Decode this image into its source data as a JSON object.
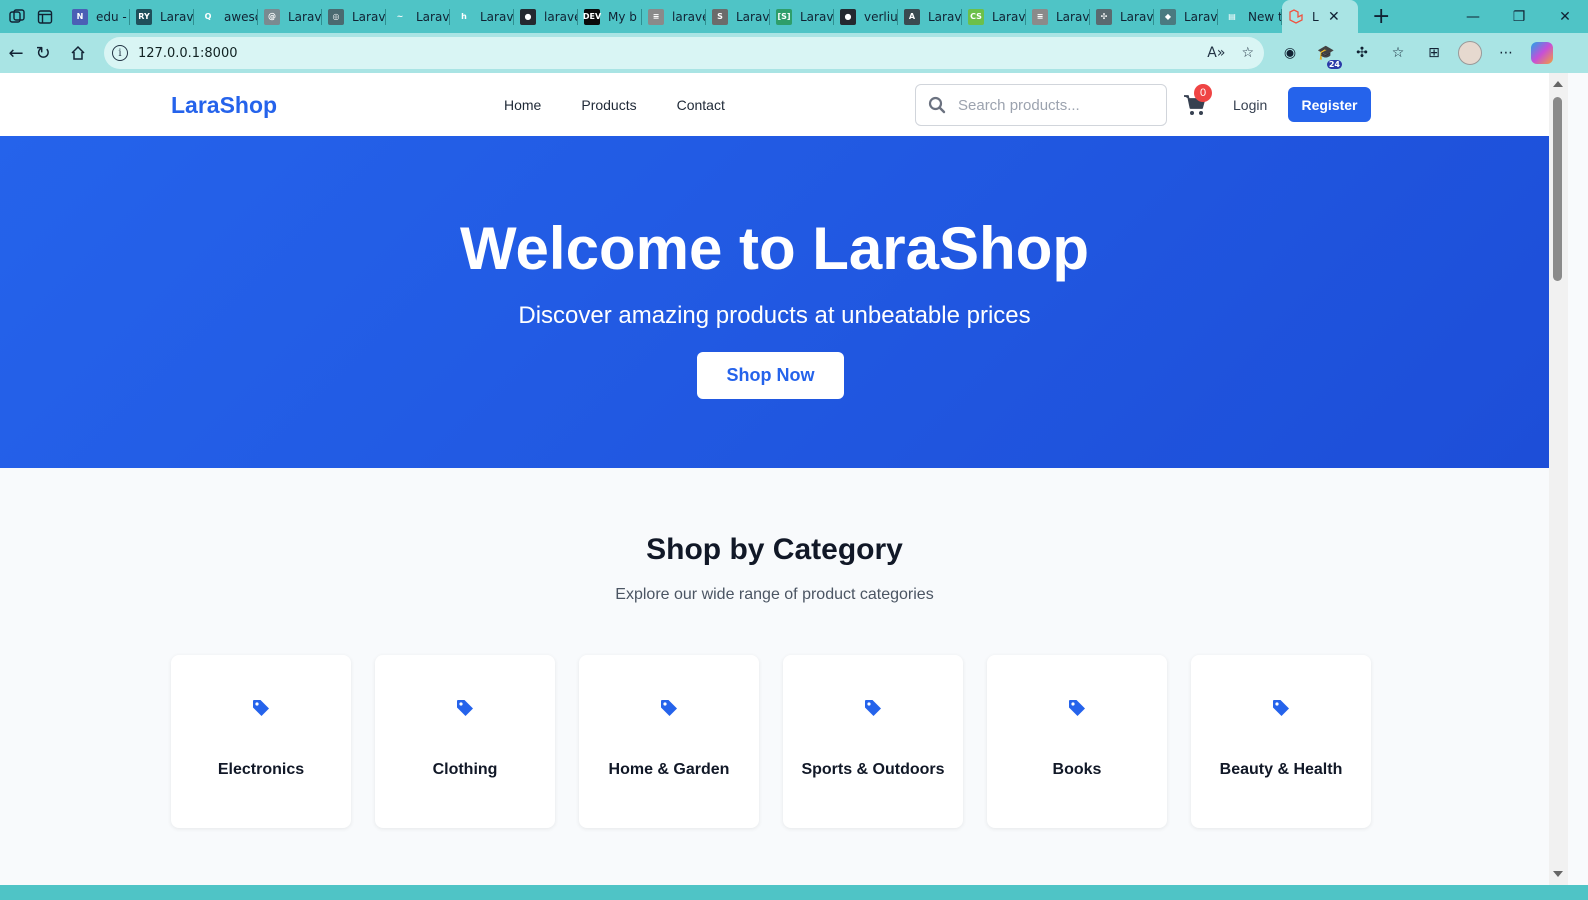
{
  "browser": {
    "tabs": [
      {
        "title": "edu -",
        "favicon_color": "#4b5fb5",
        "favicon_text": "N"
      },
      {
        "title": "Larav",
        "favicon_color": "#1f4f5a",
        "favicon_text": "RY"
      },
      {
        "title": "awesc",
        "favicon_color": "#4fc4c6",
        "favicon_text": "Q"
      },
      {
        "title": "Larav",
        "favicon_color": "#7a8a90",
        "favicon_text": "@"
      },
      {
        "title": "Larav",
        "favicon_color": "#4a6a70",
        "favicon_text": "◎"
      },
      {
        "title": "Larav",
        "favicon_color": "#4fc4c6",
        "favicon_text": "~"
      },
      {
        "title": "Larav",
        "favicon_color": "#4fc4c6",
        "favicon_text": "h"
      },
      {
        "title": "larave",
        "favicon_color": "#24292f",
        "favicon_text": "●"
      },
      {
        "title": "My b",
        "favicon_color": "#0a0a0a",
        "favicon_text": "DEV"
      },
      {
        "title": "larave",
        "favicon_color": "#8a8a8a",
        "favicon_text": "≡"
      },
      {
        "title": "Larav",
        "favicon_color": "#6b6b6b",
        "favicon_text": "S"
      },
      {
        "title": "Larav",
        "favicon_color": "#2e9e6a",
        "favicon_text": "[S]"
      },
      {
        "title": "verliu",
        "favicon_color": "#24292f",
        "favicon_text": "●"
      },
      {
        "title": "Larav",
        "favicon_color": "#3a4a50",
        "favicon_text": "A"
      },
      {
        "title": "Larav",
        "favicon_color": "#6cc04a",
        "favicon_text": "CS"
      },
      {
        "title": "Larav",
        "favicon_color": "#8a8a8a",
        "favicon_text": "≡"
      },
      {
        "title": "Larav",
        "favicon_color": "#5a6a70",
        "favicon_text": "✣"
      },
      {
        "title": "Larav",
        "favicon_color": "#4a7a80",
        "favicon_text": "◆"
      },
      {
        "title": "New t",
        "favicon_color": "#4fc4c6",
        "favicon_text": "▤"
      }
    ],
    "active_tab": {
      "title": "L",
      "favicon_color": "#f05340"
    },
    "url": "127.0.0.1:8000",
    "extension_badge": "24"
  },
  "site": {
    "logo": "LaraShop",
    "nav": {
      "home": "Home",
      "products": "Products",
      "contact": "Contact"
    },
    "search": {
      "placeholder": "Search products..."
    },
    "cart_count": "0",
    "login": "Login",
    "register": "Register",
    "accent_color": "#2563eb"
  },
  "hero": {
    "title": "Welcome to LaraShop",
    "subtitle": "Discover amazing products at unbeatable prices",
    "cta": "Shop Now"
  },
  "categories": {
    "title": "Shop by Category",
    "subtitle": "Explore our wide range of product categories",
    "icon": "tag-icon",
    "items": [
      {
        "name": "Electronics"
      },
      {
        "name": "Clothing"
      },
      {
        "name": "Home & Garden"
      },
      {
        "name": "Sports & Outdoors"
      },
      {
        "name": "Books"
      },
      {
        "name": "Beauty & Health"
      }
    ]
  }
}
